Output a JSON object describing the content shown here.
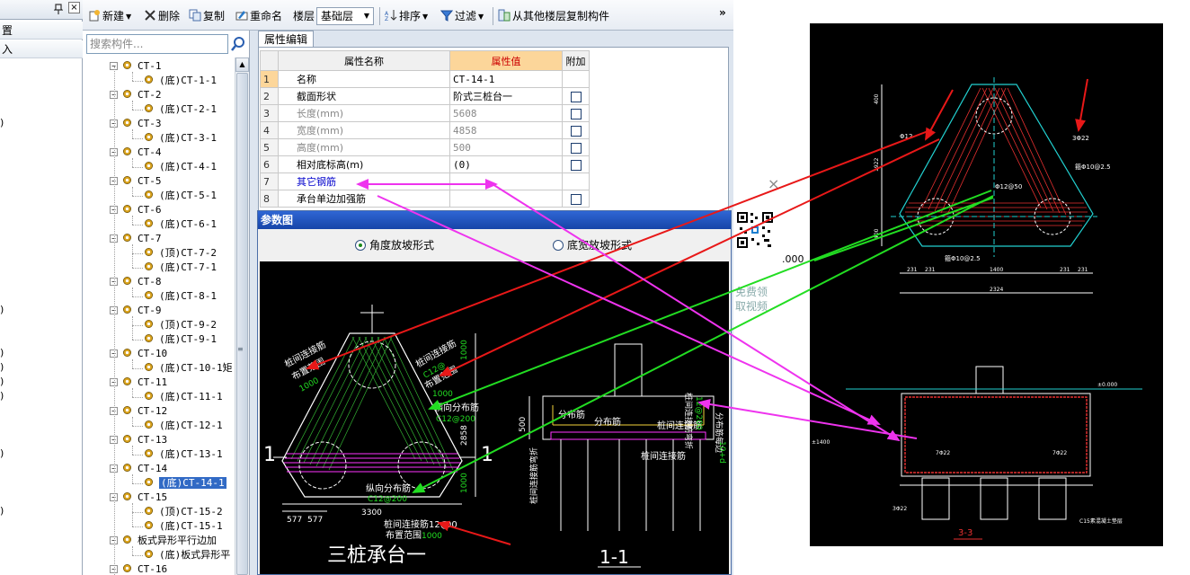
{
  "left_panel": {
    "pin_icon": "pin-icon",
    "close_glyph": "×",
    "row1_label": "置",
    "row2_label": "入",
    "paren_glyph": ")"
  },
  "toolbar": {
    "new_label": "新建",
    "delete_label": "删除",
    "copy_label": "复制",
    "rename_label": "重命名",
    "floor_label": "楼层",
    "floor_value": "基础层",
    "sort_label": "排序",
    "filter_label": "过滤",
    "copy_from_floor_label": "从其他楼层复制构件",
    "overflow_glyph": "»"
  },
  "tree": {
    "search_placeholder": "搜索构件...",
    "items": [
      {
        "level": 0,
        "label": "CT-1"
      },
      {
        "level": 1,
        "label": "(底)CT-1-1"
      },
      {
        "level": 0,
        "label": "CT-2"
      },
      {
        "level": 1,
        "label": "(底)CT-2-1"
      },
      {
        "level": 0,
        "label": "CT-3"
      },
      {
        "level": 1,
        "label": "(底)CT-3-1"
      },
      {
        "level": 0,
        "label": "CT-4"
      },
      {
        "level": 1,
        "label": "(底)CT-4-1"
      },
      {
        "level": 0,
        "label": "CT-5"
      },
      {
        "level": 1,
        "label": "(底)CT-5-1"
      },
      {
        "level": 0,
        "label": "CT-6"
      },
      {
        "level": 1,
        "label": "(底)CT-6-1"
      },
      {
        "level": 0,
        "label": "CT-7"
      },
      {
        "level": 1,
        "label": "(顶)CT-7-2"
      },
      {
        "level": 1,
        "label": "(底)CT-7-1"
      },
      {
        "level": 0,
        "label": "CT-8"
      },
      {
        "level": 1,
        "label": "(底)CT-8-1"
      },
      {
        "level": 0,
        "label": "CT-9"
      },
      {
        "level": 1,
        "label": "(顶)CT-9-2"
      },
      {
        "level": 1,
        "label": "(底)CT-9-1"
      },
      {
        "level": 0,
        "label": "CT-10"
      },
      {
        "level": 1,
        "label": "(底)CT-10-1矩"
      },
      {
        "level": 0,
        "label": "CT-11"
      },
      {
        "level": 1,
        "label": "(底)CT-11-1"
      },
      {
        "level": 0,
        "label": "CT-12"
      },
      {
        "level": 1,
        "label": "(底)CT-12-1"
      },
      {
        "level": 0,
        "label": "CT-13"
      },
      {
        "level": 1,
        "label": "(底)CT-13-1"
      },
      {
        "level": 0,
        "label": "CT-14"
      },
      {
        "level": 1,
        "label": "(底)CT-14-1",
        "selected": true
      },
      {
        "level": 0,
        "label": "CT-15"
      },
      {
        "level": 1,
        "label": "(顶)CT-15-2"
      },
      {
        "level": 1,
        "label": "(底)CT-15-1"
      },
      {
        "level": 0,
        "label": "板式异形平行边加"
      },
      {
        "level": 1,
        "label": "(底)板式异形平"
      },
      {
        "level": 0,
        "label": "CT-16"
      }
    ]
  },
  "properties": {
    "tab_label": "属性编辑",
    "headers": {
      "name": "属性名称",
      "value": "属性值",
      "extra": "附加"
    },
    "rows": [
      {
        "num": "1",
        "name": "名称",
        "value": "CT-14-1",
        "has_checkbox": false,
        "muted": false,
        "link": false
      },
      {
        "num": "2",
        "name": "截面形状",
        "value": "阶式三桩台一",
        "has_checkbox": true,
        "muted": false,
        "link": false
      },
      {
        "num": "3",
        "name": "长度(mm)",
        "value": "5608",
        "has_checkbox": true,
        "muted": true,
        "link": false
      },
      {
        "num": "4",
        "name": "宽度(mm)",
        "value": "4858",
        "has_checkbox": true,
        "muted": true,
        "link": false
      },
      {
        "num": "5",
        "name": "高度(mm)",
        "value": "500",
        "has_checkbox": true,
        "muted": true,
        "link": false
      },
      {
        "num": "6",
        "name": "相对底标高(m)",
        "value": "(0)",
        "has_checkbox": true,
        "muted": false,
        "link": false
      },
      {
        "num": "7",
        "name": "其它钢筋",
        "value": "",
        "has_checkbox": false,
        "muted": false,
        "link": true
      },
      {
        "num": "8",
        "name": "承台单边加强筋",
        "value": "",
        "has_checkbox": true,
        "muted": false,
        "link": false
      }
    ]
  },
  "param_diagram": {
    "title": "参数图",
    "radio_angle": "角度放坡形式",
    "radio_width": "底宽放坡形式",
    "plan_labels": {
      "side_mark": "1",
      "rebar_a": "桩间连接筋",
      "rebar_a_spec": "C12@",
      "range_label": "布置范围",
      "range_value": "1000",
      "transverse_dist": "横向分布筋",
      "transverse_spec": "C12@200",
      "longitudinal_dist": "纵向分布筋",
      "longitudinal_spec": "C12@200",
      "dim_3300": "3300",
      "dim_577a": "577",
      "dim_577b": "577",
      "dim_1000a": "1000",
      "dim_2858": "2858",
      "dim_1000b": "1000",
      "bottom_rebar": "桩间连接筋12@",
      "bottom_rebar_suffix": "00",
      "bottom_range": "布置范围",
      "bottom_range_value": "1000",
      "caption": "三桩承台一"
    },
    "section_labels": {
      "dist_a": "分布筋",
      "dist_b": "分布筋",
      "link_a": "桩间连接筋",
      "link_b": "桩间连接筋",
      "dim_500": "500",
      "side_dist": "分布筋每边",
      "side_value": "10+d",
      "vert_left": "桩间连接筋弯折",
      "vert_right": "桩间连接筋弯折",
      "green_vert": "12@200",
      "caption": "1-1"
    }
  },
  "ad": {
    "close_glyph": "×",
    "text_line1": "免费领",
    "text_line2": "取视频"
  },
  "drawing": {
    "dim_label_1000": ".000",
    "top_labels": {
      "rebar_r": "3Φ22",
      "rebar_top_left": "Φ12",
      "side_note": "箍Φ10@2.5",
      "center_note": "Φ12@50",
      "bottom_note": "箍Φ10@2.5",
      "dim_t1": "400",
      "dim_t2": "1922",
      "dim_t3": "400",
      "dim_b1": "231",
      "dim_b2": "231",
      "dim_b3": "1400",
      "dim_b4": "231",
      "dim_b5": "231",
      "dim_total": "2324"
    },
    "bottom_labels": {
      "elev": "±0.000",
      "rebar_left": "7Φ22",
      "rebar_right": "7Φ22",
      "bottom_left": "3Φ22",
      "c15": "C15素混凝土垫层",
      "section": "3-3",
      "left_val": "±1400"
    }
  },
  "colors": {
    "arrow_red": "#e81818",
    "arrow_green": "#22dd22",
    "arrow_magenta": "#ee33ee",
    "cad_cyan": "#22d0d0",
    "cad_red": "#e83030",
    "cad_green": "#22cc22",
    "selected_tree": "#316ac5",
    "value_header": "#fcd69a"
  }
}
